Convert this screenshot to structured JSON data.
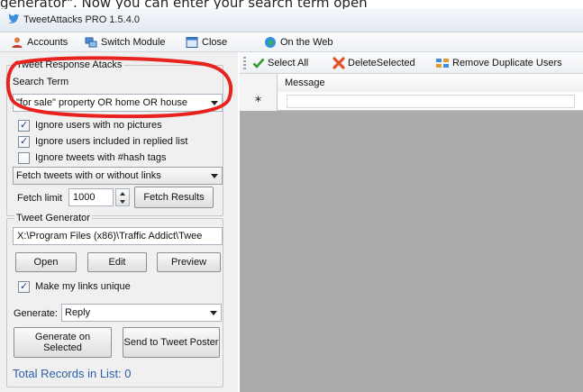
{
  "caption": "generator\". Now you can enter your search term open",
  "window": {
    "title": "TweetAttacks PRO 1.5.4.0"
  },
  "menu": [
    {
      "label": "Accounts",
      "icon": "accounts-icon"
    },
    {
      "label": "Switch Module",
      "icon": "switch-module-icon"
    },
    {
      "label": "Close",
      "icon": "close-window-icon"
    },
    {
      "label": "On the Web",
      "icon": "globe-icon"
    }
  ],
  "response": {
    "legend": "Tweet Response Atacks",
    "search_label": "Search Term",
    "search_value": "\"for sale\" property OR home OR house",
    "checkboxes": [
      {
        "label": "Ignore users with no pictures",
        "checked": true
      },
      {
        "label": "Ignore users included in replied list",
        "checked": true
      },
      {
        "label": "Ignore tweets with #hash tags",
        "checked": false
      }
    ],
    "fetch_mode": "Fetch tweets with or without links",
    "fetch_limit_label": "Fetch limit",
    "fetch_limit_value": "1000",
    "fetch_button": "Fetch Results"
  },
  "generator": {
    "legend": "Tweet Generator",
    "path": "X:\\Program Files (x86)\\Traffic Addict\\Twee",
    "open_button": "Open",
    "edit_button": "Edit",
    "preview_button": "Preview",
    "unique_label": "Make my links unique",
    "unique_checked": true,
    "generate_label": "Generate:",
    "generate_value": "Reply",
    "generate_selected_button": "Generate on Selected",
    "send_button": "Send to Tweet Poster"
  },
  "total_records": "Total Records in List: 0",
  "toolbar": {
    "select_all": "Select All",
    "delete_selected": "DeleteSelected",
    "remove_duplicates": "Remove Duplicate Users"
  },
  "grid": {
    "column": "Message",
    "new_row_marker": "*"
  },
  "colors": {
    "highlight": "#e8231f",
    "link_text": "#2b5fa8",
    "grid_background": "#ababab"
  }
}
